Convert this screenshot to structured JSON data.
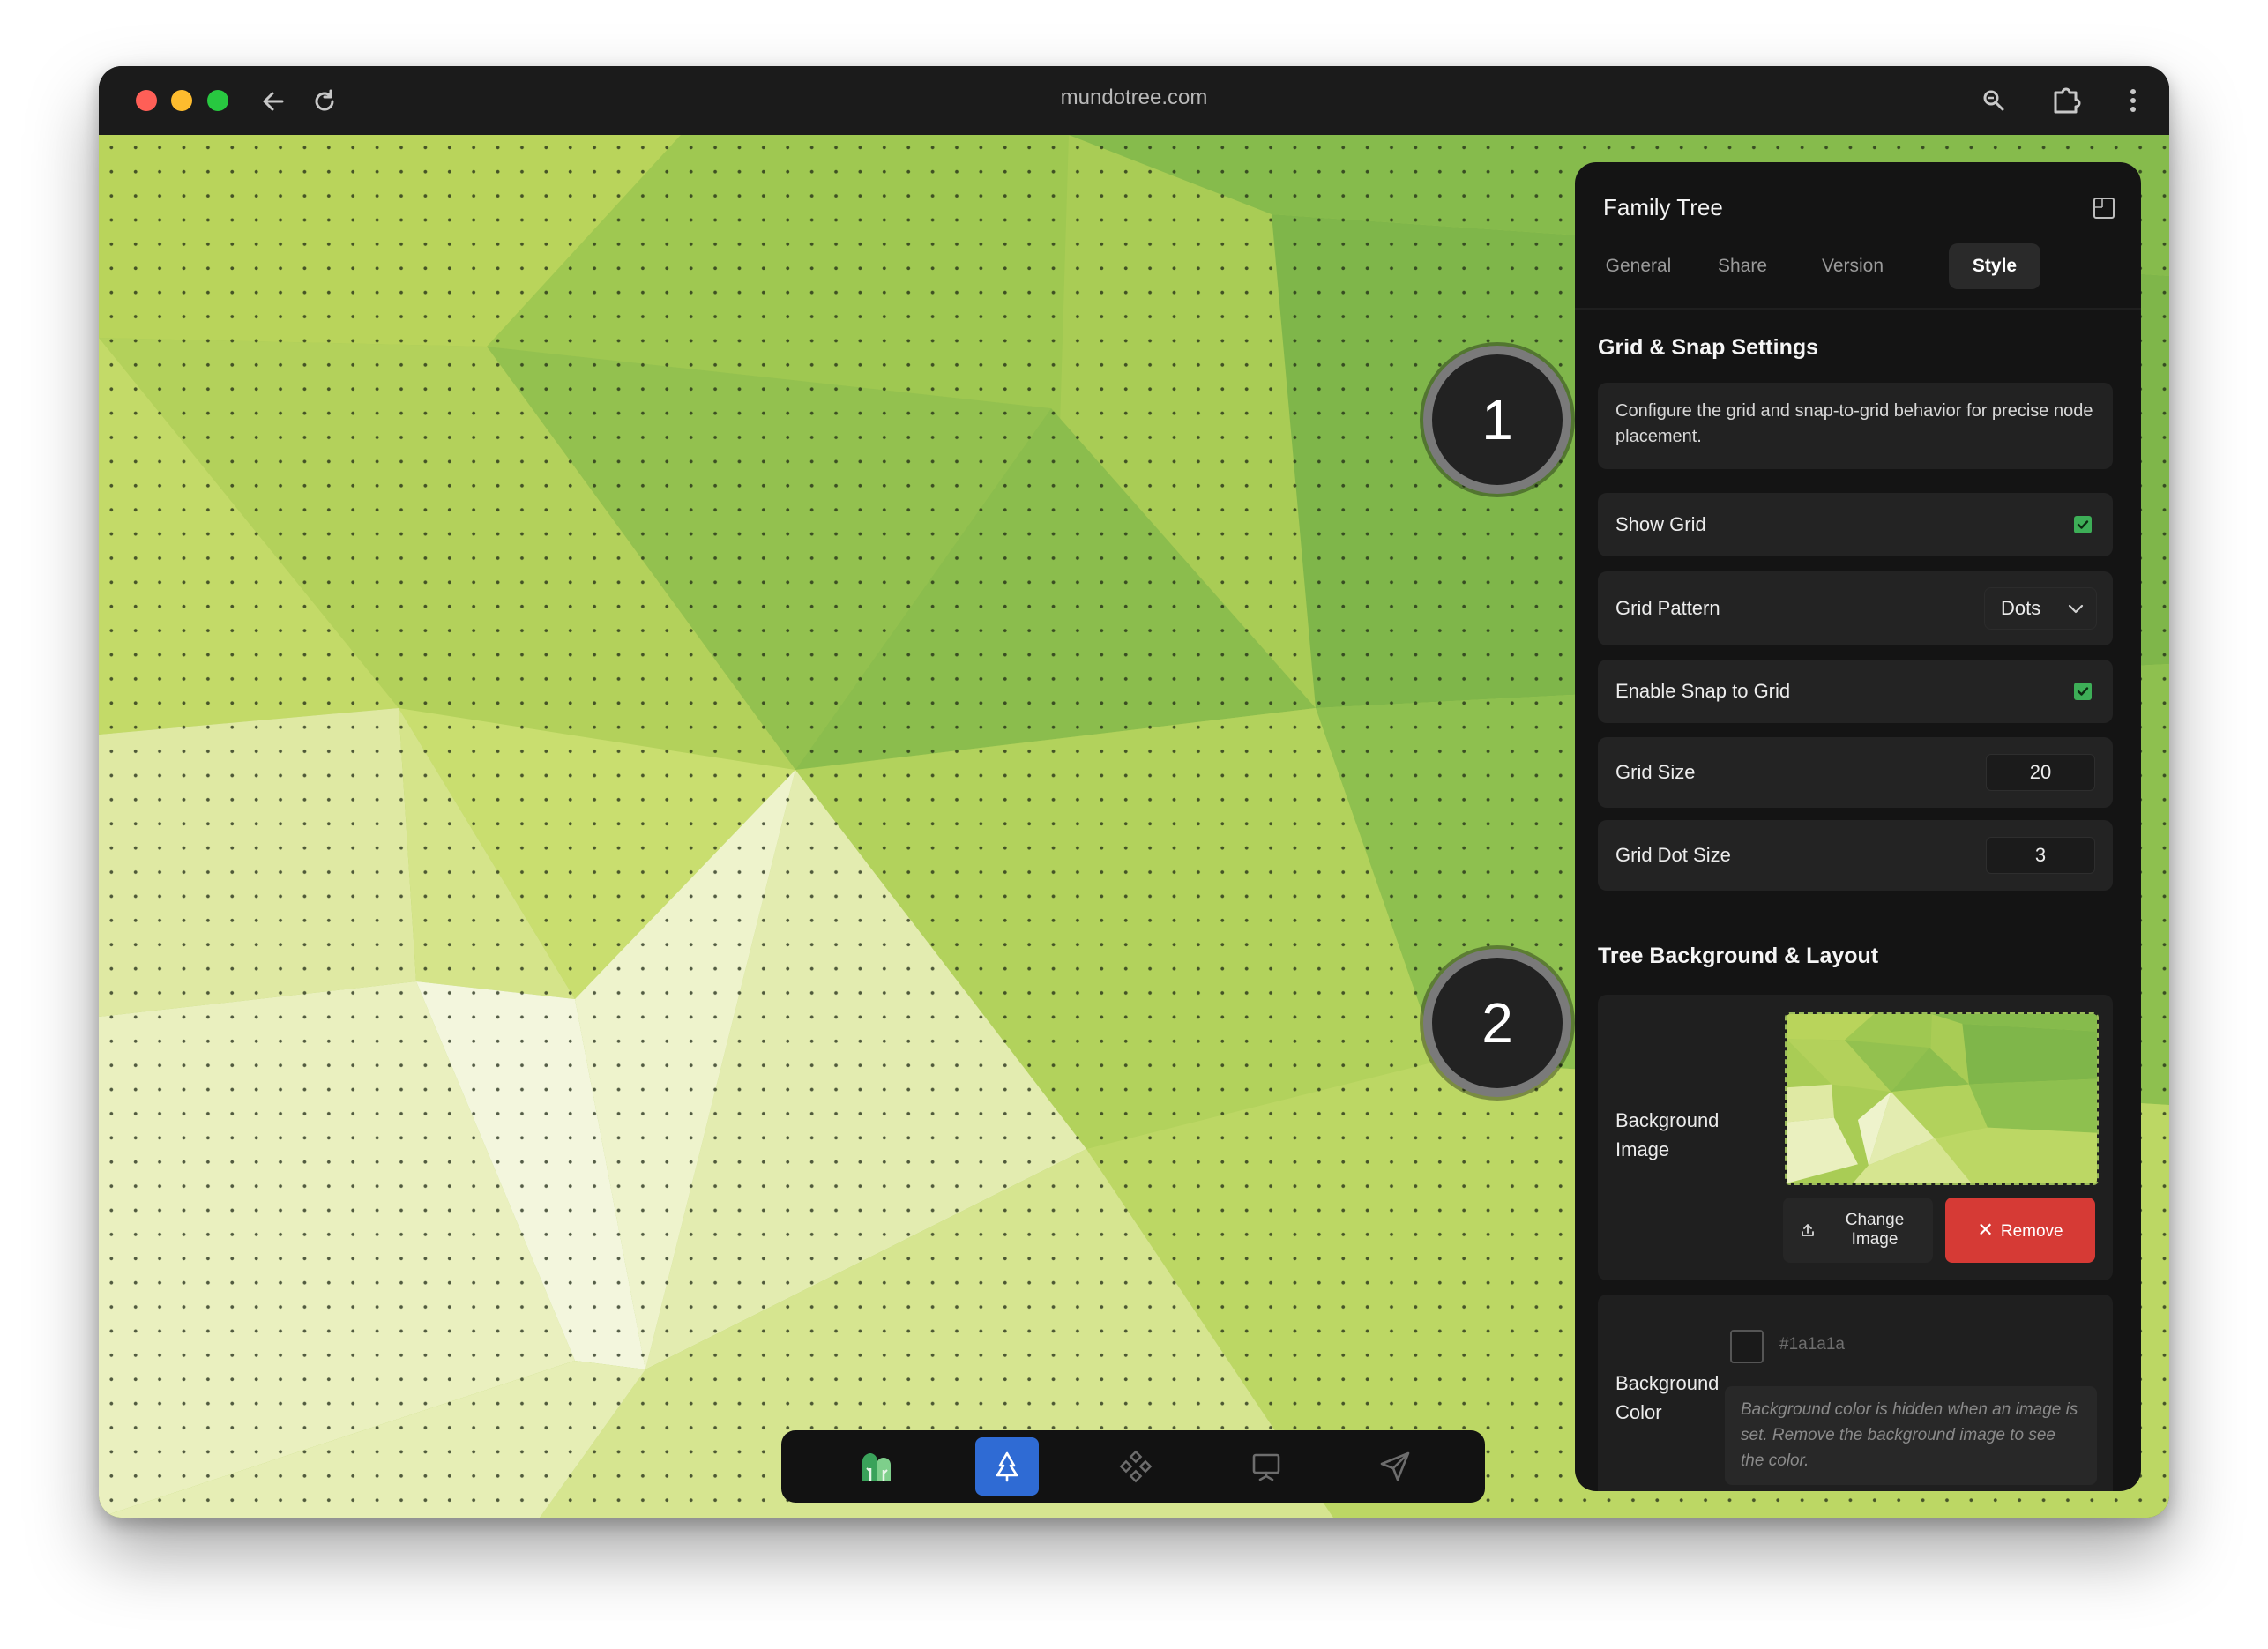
{
  "browser": {
    "url": "mundotree.com"
  },
  "markers": {
    "first": "1",
    "second": "2"
  },
  "panel": {
    "title": "Family Tree",
    "tabs": [
      {
        "label": "General",
        "active": false
      },
      {
        "label": "Share",
        "active": false
      },
      {
        "label": "Version",
        "active": false
      },
      {
        "label": "Style",
        "active": true
      }
    ],
    "grid_section": {
      "title": "Grid & Snap Settings",
      "description": "Configure the grid and snap-to-grid behavior for precise node placement.",
      "show_grid": {
        "label": "Show Grid",
        "checked": true
      },
      "grid_pattern": {
        "label": "Grid Pattern",
        "value": "Dots"
      },
      "snap": {
        "label": "Enable Snap to Grid",
        "checked": true
      },
      "grid_size": {
        "label": "Grid Size",
        "value": "20"
      },
      "dot_size": {
        "label": "Grid Dot Size",
        "value": "3"
      }
    },
    "background_section": {
      "title": "Tree Background & Layout",
      "image_label": "Background Image",
      "change_image": "Change Image",
      "remove": "Remove",
      "color_label": "Background Color",
      "color_hex": "#1a1a1a",
      "color_note": "Background color is hidden when an image is set. Remove the background image to see the color."
    }
  },
  "dock": {
    "items": [
      {
        "icon": "family-trees-icon",
        "active": false
      },
      {
        "icon": "tree-icon",
        "active": true
      },
      {
        "icon": "nodes-icon",
        "active": false
      },
      {
        "icon": "presentation-icon",
        "active": false
      },
      {
        "icon": "send-icon",
        "active": false
      }
    ]
  },
  "colors": {
    "accent": "#2f6bd4",
    "checkbox": "#3dae57",
    "danger": "#d63a35",
    "panel_bg": "#141414"
  }
}
